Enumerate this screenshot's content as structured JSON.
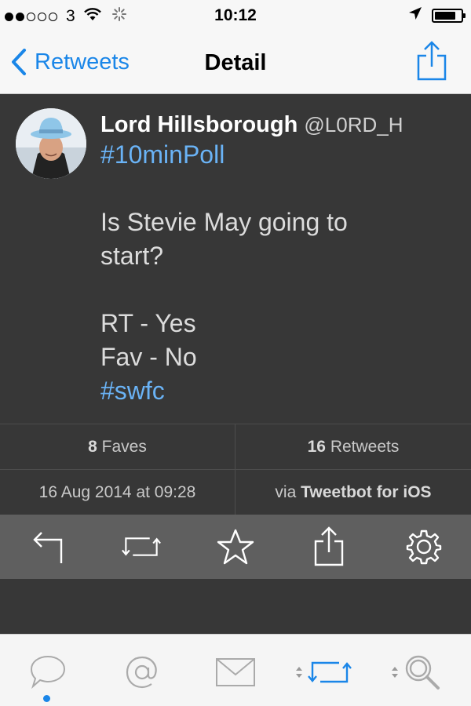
{
  "status_bar": {
    "carrier": "3",
    "time": "10:12",
    "signal_dots_filled": 2,
    "signal_dots_total": 5,
    "icons": [
      "wifi-icon",
      "activity-spinner-icon",
      "location-arrow-icon",
      "battery-icon"
    ]
  },
  "nav": {
    "back_label": "Retweets",
    "title": "Detail",
    "share_icon": "share-icon"
  },
  "tweet": {
    "author_name": "Lord Hillsborough",
    "author_handle": "@L0RD_H",
    "lines": [
      {
        "text": "#10minPoll",
        "hashtag": true
      },
      {
        "text": "",
        "hashtag": false
      },
      {
        "text": "Is Stevie May going to",
        "hashtag": false
      },
      {
        "text": "start?",
        "hashtag": false
      },
      {
        "text": "",
        "hashtag": false
      },
      {
        "text": "RT - Yes",
        "hashtag": false
      },
      {
        "text": "Fav - No",
        "hashtag": false
      },
      {
        "text": "#swfc",
        "hashtag": true
      }
    ]
  },
  "stats": {
    "faves_count": "8",
    "faves_label": "Faves",
    "retweets_count": "16",
    "retweets_label": "Retweets",
    "timestamp": "16 Aug 2014 at 09:28",
    "via_prefix": "via",
    "client": "Tweetbot for iOS"
  },
  "actions": [
    "reply-icon",
    "retweet-icon",
    "favorite-star-icon",
    "share-icon",
    "settings-gear-icon"
  ],
  "tab_bar": {
    "tabs": [
      "timeline-bubble-icon",
      "mentions-at-icon",
      "messages-envelope-icon",
      "retweets-icon",
      "search-icon"
    ],
    "active_tab": 0
  },
  "colors": {
    "accent": "#1a86e8",
    "hashtag": "#6ab3f6",
    "tweet_bg": "#373737",
    "actions_bg": "#5f5f5f"
  }
}
